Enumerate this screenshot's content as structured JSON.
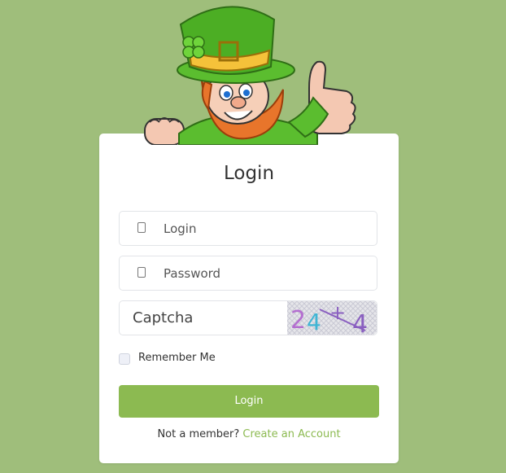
{
  "colors": {
    "background": "#9fbe7b",
    "card": "#ffffff",
    "button": "#8cba51",
    "link": "#8cba51"
  },
  "mascot": {
    "icon": "leprechaun-mascot"
  },
  "form": {
    "title": "Login",
    "login_placeholder": "Login",
    "password_placeholder": "Password",
    "captcha_placeholder": "Captcha",
    "captcha_image_text": "24+4",
    "remember_label": "Remember Me",
    "remember_checked": false,
    "submit_label": "Login",
    "signup_prompt": "Not a member?",
    "signup_link": "Create an Account"
  }
}
